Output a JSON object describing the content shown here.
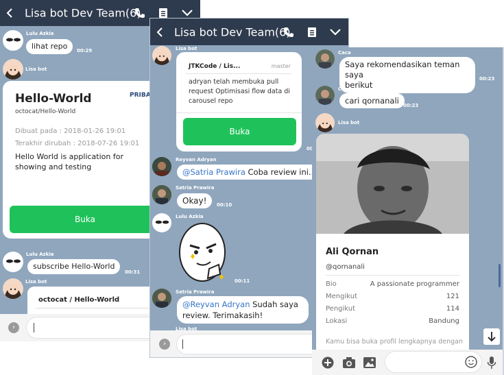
{
  "window1": {
    "title": "Lisa bot Dev Team(6)",
    "msg1": {
      "sender": "Lulu Azkia",
      "text": "lihat repo",
      "time": "00:29"
    },
    "bot_name": "Lisa bot",
    "repo_card": {
      "title": "Hello-World",
      "badge": "PRIBADI",
      "path": "octocat/Hello-World",
      "created": "Dibuat pada : 2018-01-26 19:01",
      "updated": "Terakhir dirubah : 2018-07-26 19:01",
      "description": "Hello World is application for showing and testing",
      "button": "Buka"
    },
    "msg2": {
      "sender": "Lulu Azkia",
      "text": "subscribe Hello-World",
      "time": "00:31"
    },
    "bot_name2": "Lisa bot",
    "card2_title": "octocat / Hello-World"
  },
  "window2": {
    "title": "Lisa bot Dev Team(6)",
    "bot_name": "Lisa bot",
    "pr_card": {
      "title": "JTKCode / Lis...",
      "branch": "master",
      "text": "adryan telah membuka pull request Optimisasi flow data di carousel repo",
      "button": "Buka"
    },
    "time_pr": "00:",
    "msg1": {
      "sender": "Reyvan Adryan",
      "mention": "@Satria Prawira",
      "text": " Coba review ini.."
    },
    "msg2": {
      "sender": "Satria Prawira",
      "text": "Okay!",
      "time": "00:10"
    },
    "sticker_sender": "Lulu Azkia",
    "sticker_time": "00:11",
    "msg3": {
      "sender": "Satria Prawira",
      "mention": "@Reyvan Adryan",
      "text": " Sudah saya review. Terimakasih!"
    },
    "bot_name_cut": "Lisa bot"
  },
  "window3": {
    "msg1": {
      "sender": "Caca",
      "text_line1": "Saya rekomendasikan teman saya",
      "text_line2": "berikut",
      "time": "00:23"
    },
    "msg2": {
      "sender": "Caca",
      "text": "cari qornanali",
      "time": "00:23"
    },
    "bot_name": "Lisa bot",
    "profile": {
      "name": "Ali Qornan",
      "username": "@qornanali",
      "rows": [
        {
          "label": "Bio",
          "value": "A passionate programmer"
        },
        {
          "label": "Mengikut",
          "value": "121"
        },
        {
          "label": "Pengikut",
          "value": "114"
        },
        {
          "label": "Lokasi",
          "value": "Bandung"
        }
      ],
      "footer": "Kamu bisa buka profil lengkapnya dengan"
    }
  },
  "colors": {
    "header": "#2e3a4d",
    "chat_bg": "#8fa6bd",
    "green": "#1fc25a",
    "mention": "#3574c9"
  }
}
